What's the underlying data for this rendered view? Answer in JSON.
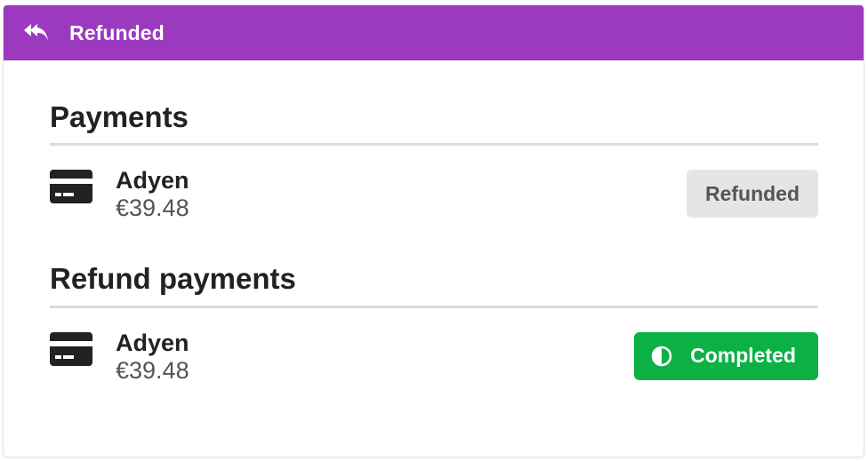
{
  "header": {
    "icon": "reply-all-icon",
    "title": "Refunded",
    "color": "#9c3abf"
  },
  "sections": [
    {
      "title": "Payments",
      "payment": {
        "icon": "credit-card-icon",
        "method": "Adyen",
        "amount": "€39.48",
        "status": "Refunded",
        "status_color": "#e5e5e5"
      }
    },
    {
      "title": "Refund payments",
      "payment": {
        "icon": "credit-card-icon",
        "method": "Adyen",
        "amount": "€39.48",
        "status": "Completed",
        "status_icon": "half-circle-icon",
        "status_color": "#0bb145"
      }
    }
  ]
}
